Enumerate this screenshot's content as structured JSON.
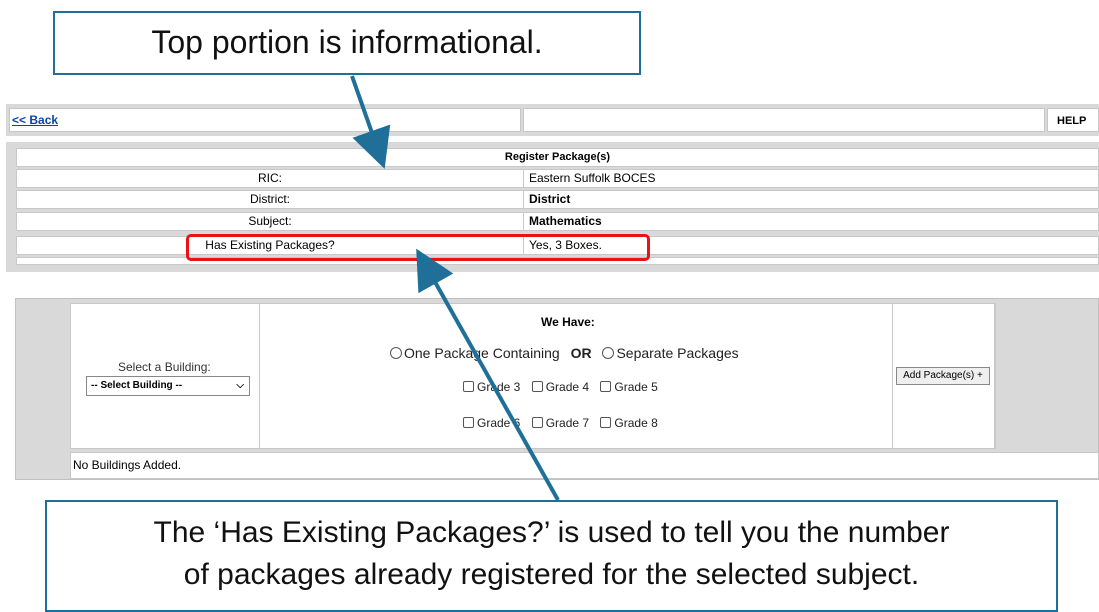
{
  "nav": {
    "back_label": "<< Back",
    "help_label": "HELP"
  },
  "info": {
    "title": "Register Package(s)",
    "rows": [
      {
        "label": "RIC:",
        "value": "Eastern Suffolk BOCES"
      },
      {
        "label": "District:",
        "value": "District"
      },
      {
        "label": "Subject:",
        "value": "Mathematics"
      },
      {
        "label": "Has Existing Packages?",
        "value": "Yes, 3 Boxes."
      }
    ]
  },
  "form": {
    "building_label": "Select a Building:",
    "building_select": "-- Select Building --",
    "we_have_label": "We Have:",
    "option_one": "One Package Containing",
    "or_label": "OR",
    "option_two": "Separate Packages",
    "grades": [
      "Grade 3",
      "Grade 4",
      "Grade 5",
      "Grade 6",
      "Grade 7",
      "Grade 8"
    ],
    "add_button": "Add Package(s) +",
    "status": "No Buildings Added."
  },
  "callouts": {
    "top": "Top portion is informational.",
    "bottom_line1": "The ‘Has Existing Packages?’ is used to tell you the number",
    "bottom_line2": "of packages already registered for the selected subject."
  },
  "colors": {
    "callout_border": "#1f6f99",
    "highlight": "#e11111",
    "link": "#0645ad"
  }
}
